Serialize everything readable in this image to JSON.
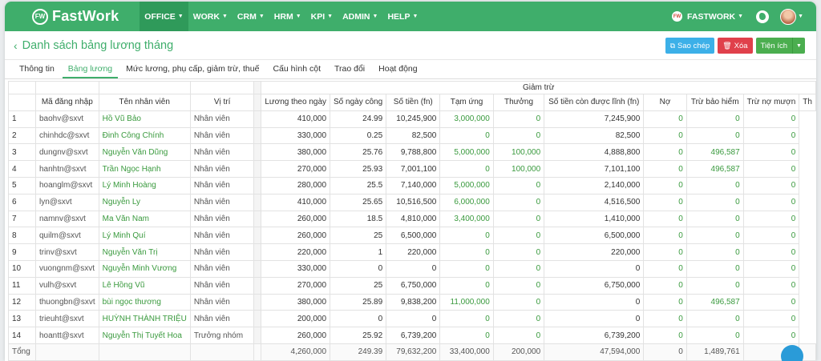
{
  "nav": {
    "logo_badge": "FW",
    "logo_text": "FastWork",
    "items": [
      "OFFICE",
      "WORK",
      "CRM",
      "HRM",
      "KPI",
      "ADMIN",
      "HELP"
    ],
    "org_badge": "FW",
    "org_name": "FASTWORK"
  },
  "header": {
    "title": "Danh sách bảng lương tháng",
    "copy_label": "Sao chép",
    "delete_label": "Xóa",
    "utility_label": "Tiện ích"
  },
  "tabs": [
    "Thông tin",
    "Bảng lương",
    "Mức lương, phụ cấp, giảm trừ, thuế",
    "Cấu hình cột",
    "Trao đổi",
    "Hoạt động"
  ],
  "table": {
    "group_header": "Giảm trừ",
    "columns": [
      "Mã đăng nhập",
      "Tên nhân viên",
      "Vị trí",
      "Lương theo ngày",
      "Số ngày công",
      "Số tiền (fn)",
      "Tạm ứng",
      "Thưởng",
      "Số tiền còn được lĩnh (fn)",
      "Nợ",
      "Trừ bảo hiểm",
      "Trừ nợ mượn",
      "Th"
    ],
    "rows": [
      [
        "1",
        "baohv@sxvt",
        "Hồ Vũ Bảo",
        "Nhân viên",
        "410,000",
        "24.99",
        "10,245,900",
        "3,000,000",
        "0",
        "7,245,900",
        "0",
        "0",
        "0"
      ],
      [
        "2",
        "chinhdc@sxvt",
        "Đinh Công Chính",
        "Nhân viên",
        "330,000",
        "0.25",
        "82,500",
        "0",
        "0",
        "82,500",
        "0",
        "0",
        "0"
      ],
      [
        "3",
        "dungnv@sxvt",
        "Nguyễn Văn Dũng",
        "Nhân viên",
        "380,000",
        "25.76",
        "9,788,800",
        "5,000,000",
        "100,000",
        "4,888,800",
        "0",
        "496,587",
        "0"
      ],
      [
        "4",
        "hanhtn@sxvt",
        "Trần Ngọc Hạnh",
        "Nhân viên",
        "270,000",
        "25.93",
        "7,001,100",
        "0",
        "100,000",
        "7,101,100",
        "0",
        "496,587",
        "0"
      ],
      [
        "5",
        "hoanglm@sxvt",
        "Lý Minh Hoàng",
        "Nhân viên",
        "280,000",
        "25.5",
        "7,140,000",
        "5,000,000",
        "0",
        "2,140,000",
        "0",
        "0",
        "0"
      ],
      [
        "6",
        "lyn@sxvt",
        "Nguyễn Ly",
        "Nhân viên",
        "410,000",
        "25.65",
        "10,516,500",
        "6,000,000",
        "0",
        "4,516,500",
        "0",
        "0",
        "0"
      ],
      [
        "7",
        "namnv@sxvt",
        "Ma Văn Nam",
        "Nhân viên",
        "260,000",
        "18.5",
        "4,810,000",
        "3,400,000",
        "0",
        "1,410,000",
        "0",
        "0",
        "0"
      ],
      [
        "8",
        "quilm@sxvt",
        "Lý Minh Quí",
        "Nhân viên",
        "260,000",
        "25",
        "6,500,000",
        "0",
        "0",
        "6,500,000",
        "0",
        "0",
        "0"
      ],
      [
        "9",
        "trinv@sxvt",
        "Nguyễn Văn Trị",
        "Nhân viên",
        "220,000",
        "1",
        "220,000",
        "0",
        "0",
        "220,000",
        "0",
        "0",
        "0"
      ],
      [
        "10",
        "vuongnm@sxvt",
        "Nguyễn Minh Vương",
        "Nhân viên",
        "330,000",
        "0",
        "0",
        "0",
        "0",
        "0",
        "0",
        "0",
        "0"
      ],
      [
        "11",
        "vulh@sxvt",
        "Lê Hồng Vũ",
        "Nhân viên",
        "270,000",
        "25",
        "6,750,000",
        "0",
        "0",
        "6,750,000",
        "0",
        "0",
        "0"
      ],
      [
        "12",
        "thuongbn@sxvt",
        "bùi ngọc thương",
        "Nhân viên",
        "380,000",
        "25.89",
        "9,838,200",
        "11,000,000",
        "0",
        "0",
        "0",
        "496,587",
        "0"
      ],
      [
        "13",
        "trieuht@sxvt",
        "HUỲNH THÀNH TRIỆU",
        "Nhân viên",
        "200,000",
        "0",
        "0",
        "0",
        "0",
        "0",
        "0",
        "0",
        "0"
      ],
      [
        "14",
        "hoantt@sxvt",
        "Nguyễn Thị Tuyết Hoa",
        "Trưởng nhóm",
        "260,000",
        "25.92",
        "6,739,200",
        "0",
        "0",
        "6,739,200",
        "0",
        "0",
        "0"
      ]
    ],
    "total_label": "Tổng",
    "totals": [
      "4,260,000",
      "249.39",
      "79,632,200",
      "33,400,000",
      "200,000",
      "47,594,000",
      "0",
      "1,489,761",
      "0"
    ]
  },
  "colors": {
    "brand": "#3fae6b",
    "link": "#3a9a3e"
  }
}
